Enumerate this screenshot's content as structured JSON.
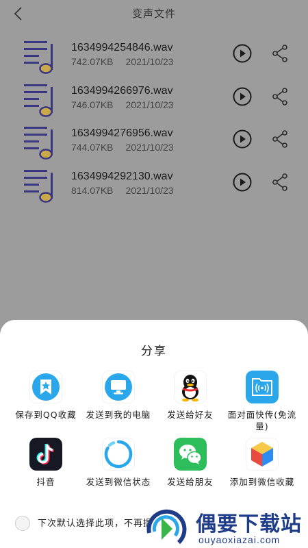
{
  "header": {
    "title": "变声文件"
  },
  "files": [
    {
      "name": "1634994254846.wav",
      "size": "742.07KB",
      "date": "2021/10/23"
    },
    {
      "name": "1634994266976.wav",
      "size": "746.07KB",
      "date": "2021/10/23"
    },
    {
      "name": "1634994276956.wav",
      "size": "744.07KB",
      "date": "2021/10/23"
    },
    {
      "name": "1634994292130.wav",
      "size": "814.07KB",
      "date": "2021/10/23"
    }
  ],
  "share_sheet": {
    "title": "分享",
    "targets": [
      {
        "label": "保存到QQ收藏",
        "icon": "qq-favorites-icon"
      },
      {
        "label": "发送到我的电脑",
        "icon": "my-computer-icon"
      },
      {
        "label": "发送给好友",
        "icon": "qq-penguin-icon"
      },
      {
        "label": "面对面快传(免流量)",
        "icon": "face-to-face-transfer-icon"
      },
      {
        "label": "抖音",
        "icon": "douyin-icon"
      },
      {
        "label": "发送到微信状态",
        "icon": "wechat-status-icon"
      },
      {
        "label": "发送给朋友",
        "icon": "wechat-icon"
      },
      {
        "label": "添加到微信收藏",
        "icon": "wechat-favorites-icon"
      }
    ],
    "remember_choice_label": "下次默认选择此项，不再提示"
  },
  "watermark": {
    "text": "偶要下载站",
    "domain": "ouyaoxiazai.com"
  },
  "colors": {
    "overlay": "#9c9c9c",
    "music_icon": "#3b3680",
    "music_note": "#c9a94a",
    "qq_blue": "#2aa7ea",
    "wechat_green": "#2dbd5a"
  }
}
